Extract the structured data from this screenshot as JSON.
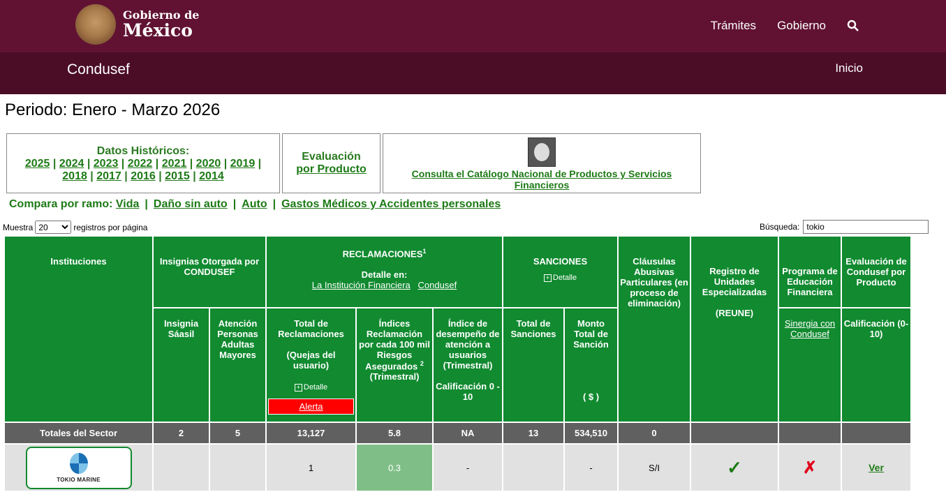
{
  "header": {
    "logo_small": "Gobierno de",
    "logo_big": "México",
    "nav": [
      "Trámites",
      "Gobierno"
    ],
    "search_icon": "search-icon"
  },
  "subheader": {
    "brand": "Condusef",
    "inicio": "Inicio"
  },
  "periodo": "Periodo: Enero - Marzo 2026",
  "historicos": {
    "title": "Datos Históricos:",
    "years_row1": [
      "2025",
      "2024",
      "2023",
      "2022",
      "2021",
      "2020",
      "2019"
    ],
    "years_row2": [
      "2018",
      "2017",
      "2016",
      "2015",
      "2014"
    ]
  },
  "evaluacion": {
    "line1": "Evaluación",
    "line2": "por Producto"
  },
  "catalogo": {
    "line1": "Consulta el Catálogo Nacional de Productos y Servicios",
    "line2": "Financieros"
  },
  "compara": {
    "label": "Compara por ramo:",
    "items": [
      "Vida",
      "Daño sin auto",
      "Auto",
      "Gastos Médicos y Accidentes personales"
    ]
  },
  "muestra": {
    "prefix": "Muestra",
    "value": "20",
    "suffix": "registros por página"
  },
  "busqueda": {
    "label": "Búsqueda:",
    "value": "tokio"
  },
  "table": {
    "instituciones": "Instituciones",
    "insignias": "Insignias Otorgada por CONDUSEF",
    "reclamaciones": "RECLAMACIONES",
    "reclamaciones_sup": "1",
    "detalle_en": "Detalle en:",
    "link_institucion": "La Institución Financiera",
    "link_condusef": "Condusef",
    "sanciones": "SANCIONES",
    "detalle": "Detalle",
    "clausulas": "Cláusulas Abusivas Particulares (en proceso de eliminación)",
    "registro": "Registro de Unidades Especializadas",
    "reune": "(REUNE)",
    "programa": "Programa de Educación Financiera",
    "sinergia": "Sinergia con Condusef",
    "evaluacion_condusef": "Evaluación de Condusef por Producto",
    "calificacion": "Calificación (0-10)",
    "insignia_saasil": "Insignia Sáasil",
    "atencion_adultas": "Atención Personas Adultas Mayores",
    "total_reclamaciones": "Total de Reclamaciones",
    "quejas": "(Quejas del usuario)",
    "alerta": "Alerta",
    "indices": "Índices Reclamación por cada 100 mil Riesgos Asegurados",
    "indices_sup": "2",
    "trimestral": "(Trimestral)",
    "indice_desempeno": "Índice de desempeño de atención a usuarios (Trimestral)",
    "calif_0_10": "Calificación 0 - 10",
    "total_sanciones": "Total de Sanciones",
    "monto_total": "Monto Total de Sanción",
    "moneda": "( $ )",
    "totales": [
      "Totales del Sector",
      "2",
      "5",
      "13,127",
      "5.8",
      "NA",
      "13",
      "534,510",
      "0",
      "",
      "",
      ""
    ],
    "row": {
      "logo_text": "TOKIO MARINE",
      "insignia": "",
      "atencion": "",
      "total": "1",
      "indice": "0.3",
      "desempeno": "-",
      "sanciones": "",
      "monto": "-",
      "clausulas": "S/I",
      "reune_icon": "check-icon",
      "sinergia_icon": "cross-icon",
      "ver": "Ver"
    }
  },
  "colors": {
    "header": "#611232",
    "subheader": "#4b0d26",
    "table_green": "#118a30",
    "link_green": "#1d7a16",
    "alert": "#ff0000"
  }
}
